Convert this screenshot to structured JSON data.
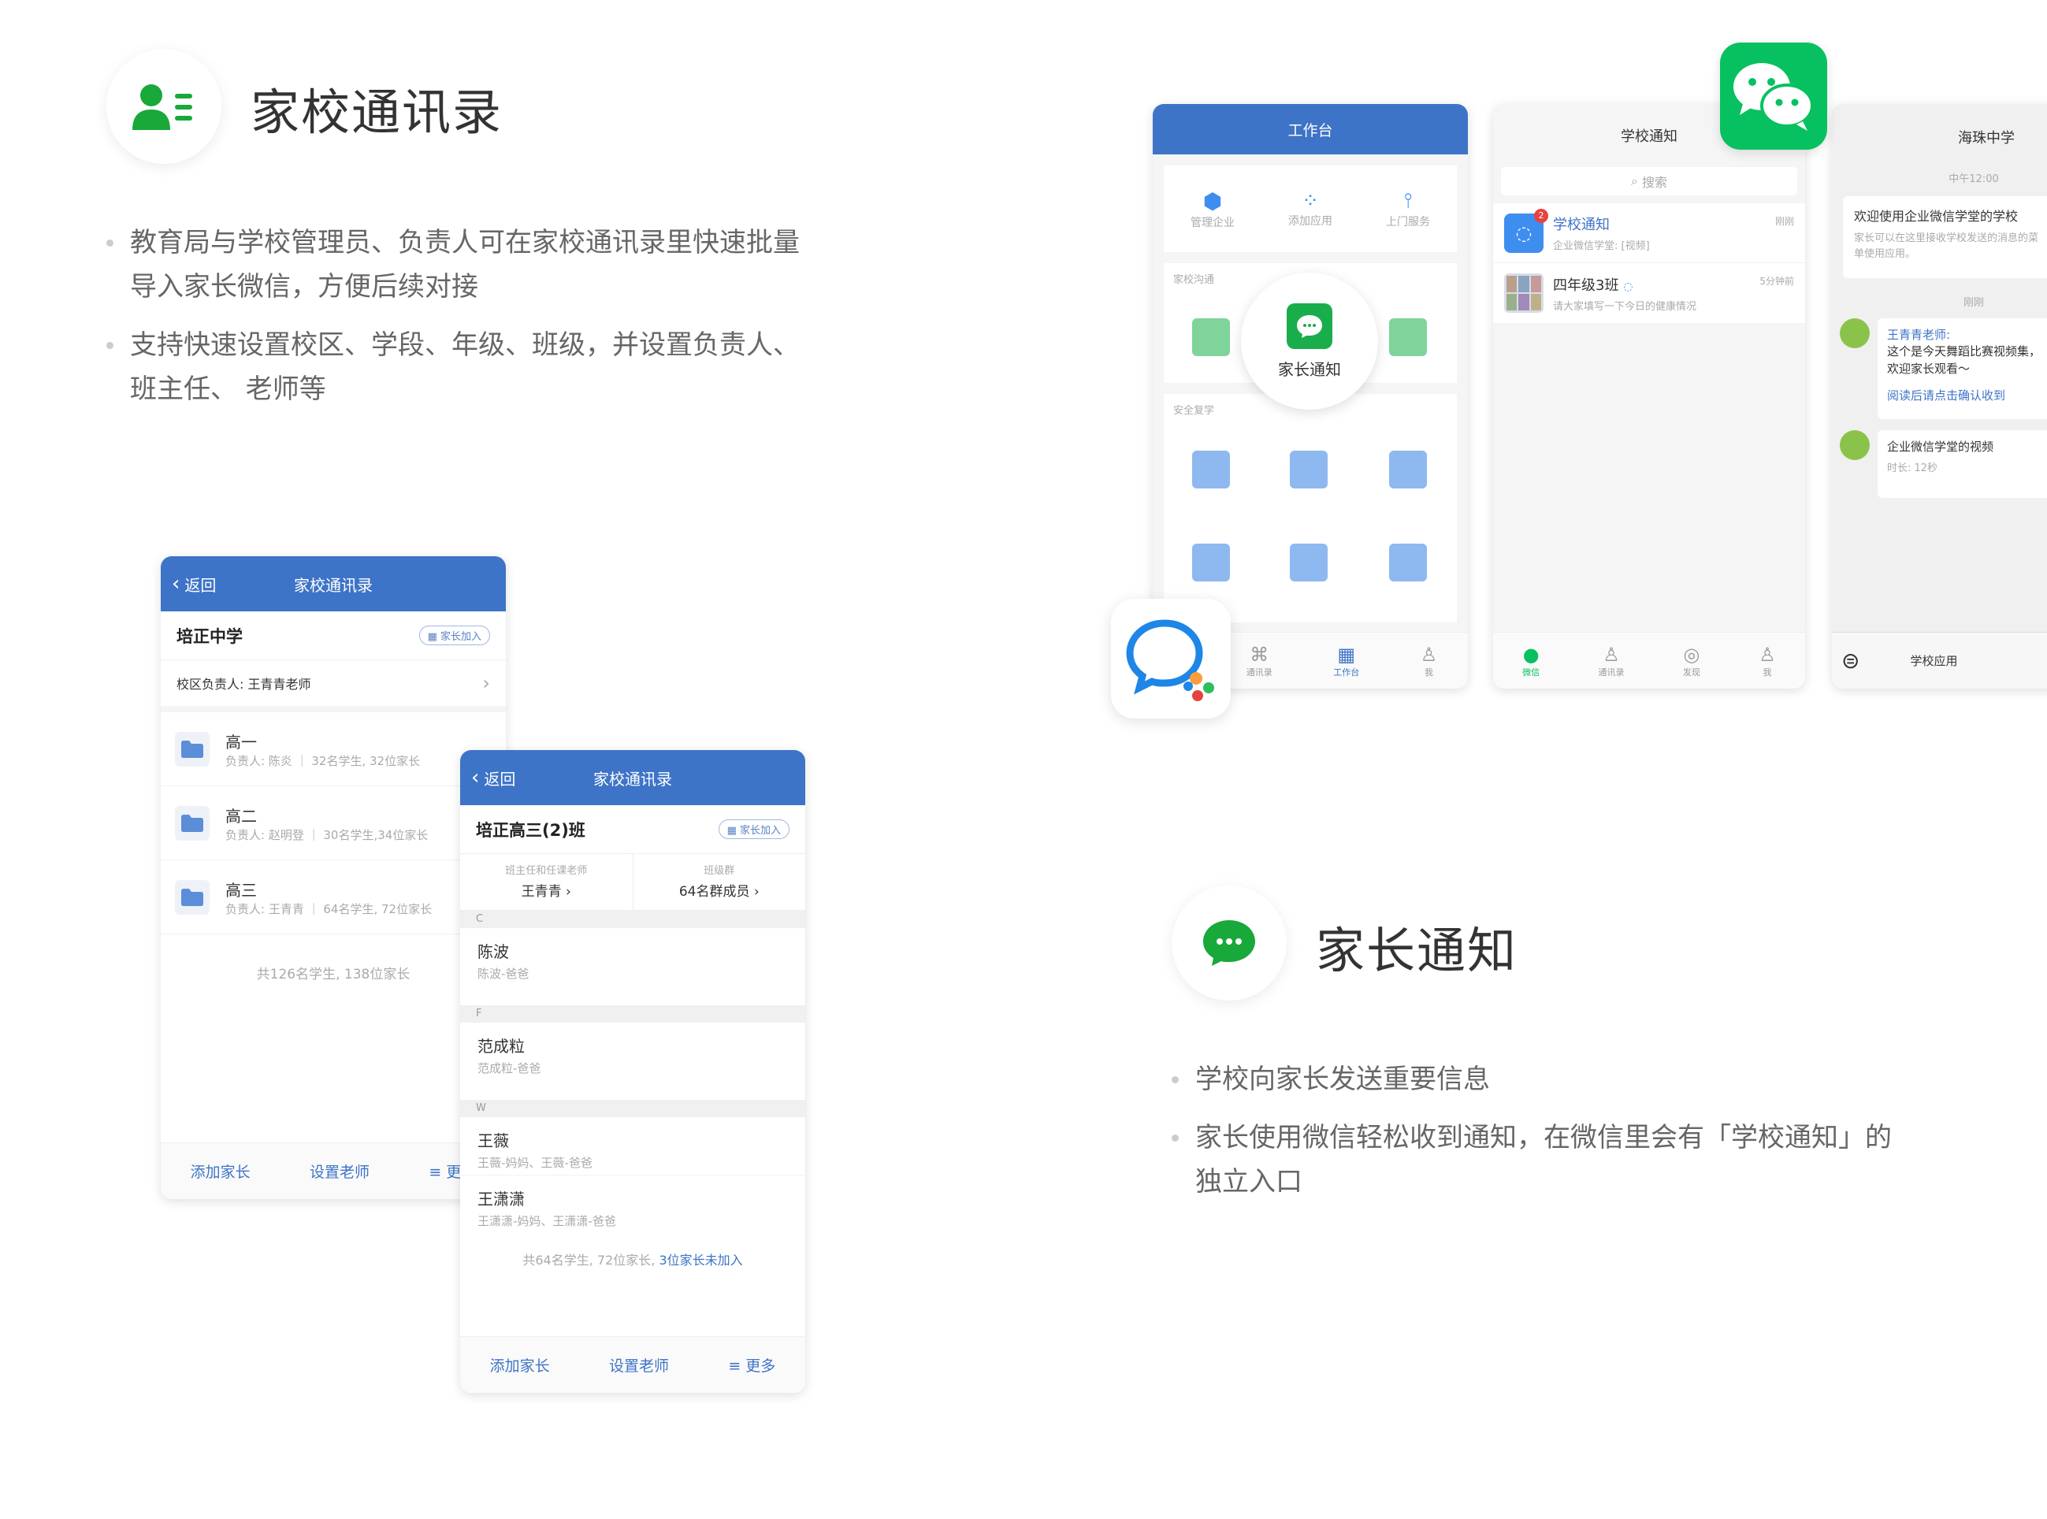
{
  "section1": {
    "title": "家校通讯录",
    "bullets": [
      "教育局与学校管理员、负责人可在家校通讯录里快速批量导入家长微信，方便后续对接",
      "支持快速设置校区、学段、年级、班级，并设置负责人、班主任、 老师等"
    ]
  },
  "section2": {
    "title": "家长通知",
    "bullets": [
      "学校向家长发送重要信息",
      "家长使用微信轻松收到通知，在微信里会有「学校通知」的独立入口"
    ]
  },
  "phoneA": {
    "back": "返回",
    "title": "家校通讯录",
    "school": "培正中学",
    "join": "家长加入",
    "campus_head": "校区负责人: 王青青老师",
    "grades": [
      {
        "name": "高一",
        "detail": "负责人: 陈炎 ｜ 32名学生, 32位家长"
      },
      {
        "name": "高二",
        "detail": "负责人: 赵明登 ｜ 30名学生,34位家长"
      },
      {
        "name": "高三",
        "detail": "负责人: 王青青 ｜ 64名学生, 72位家长"
      }
    ],
    "total": "共126名学生, 138位家长",
    "footer": [
      "添加家长",
      "设置老师",
      "≡ 更多"
    ]
  },
  "phoneB": {
    "back": "返回",
    "title": "家校通讯录",
    "class_name": "培正高三(2)班",
    "join": "家长加入",
    "teacher_label": "班主任和任课老师",
    "teacher_value": "王青青 ›",
    "group_label": "班级群",
    "group_value": "64名群成员 ›",
    "sections": [
      {
        "letter": "C",
        "contacts": [
          {
            "name": "陈波",
            "sub": "陈波-爸爸"
          }
        ]
      },
      {
        "letter": "F",
        "contacts": [
          {
            "name": "范成粒",
            "sub": "范成粒-爸爸"
          }
        ]
      },
      {
        "letter": "W",
        "contacts": [
          {
            "name": "王薇",
            "sub": "王薇-妈妈、王薇-爸爸"
          },
          {
            "name": "王潇潇",
            "sub": "王潇潇-妈妈、王潇潇-爸爸"
          }
        ]
      }
    ],
    "total_prefix": "共64名学生, 72位家长, ",
    "total_link": "3位家长未加入",
    "footer": [
      "添加家长",
      "设置老师",
      "≡ 更多"
    ]
  },
  "workbench": {
    "title": "工作台",
    "apps": [
      "管理企业",
      "添加应用",
      "上门服务"
    ],
    "group1": "家校沟通",
    "group2": "安全复学",
    "bubble": "家长通知",
    "tabs": [
      "通讯录",
      "工作台",
      "我"
    ]
  },
  "wechat": {
    "title": "学校通知",
    "search": "搜索",
    "chats": [
      {
        "name": "学校通知",
        "preview": "企业微信学堂: [视频]",
        "time": "刚刚",
        "badge": "2"
      },
      {
        "name": "四年级3班",
        "preview": "请大家填写一下今日的健康情况",
        "time": "5分钟前"
      }
    ],
    "tabs": [
      "微信",
      "通讯录",
      "发现",
      "我"
    ]
  },
  "school_chat": {
    "title": "海珠中学",
    "time1": "中午12:00",
    "welcome_title": "欢迎使用企业微信学堂的学校",
    "welcome_body": "家长可以在这里接收学校发送的消息的菜单使用应用。",
    "time2": "刚刚",
    "msg_sender": "王青青老师:",
    "msg_text": "这个是今天舞蹈比赛视频集，欢迎家长观看～",
    "msg_link": "阅读后请点击确认收到",
    "video_title": "企业微信学堂的视频",
    "video_len": "时长: 12秒",
    "bottom": "学校应用"
  },
  "colors": {
    "brand_blue": "#3e74c7",
    "wechat_green": "#07c160",
    "tile_green": "#7ed49a",
    "tile_blue": "#8db8f0"
  }
}
